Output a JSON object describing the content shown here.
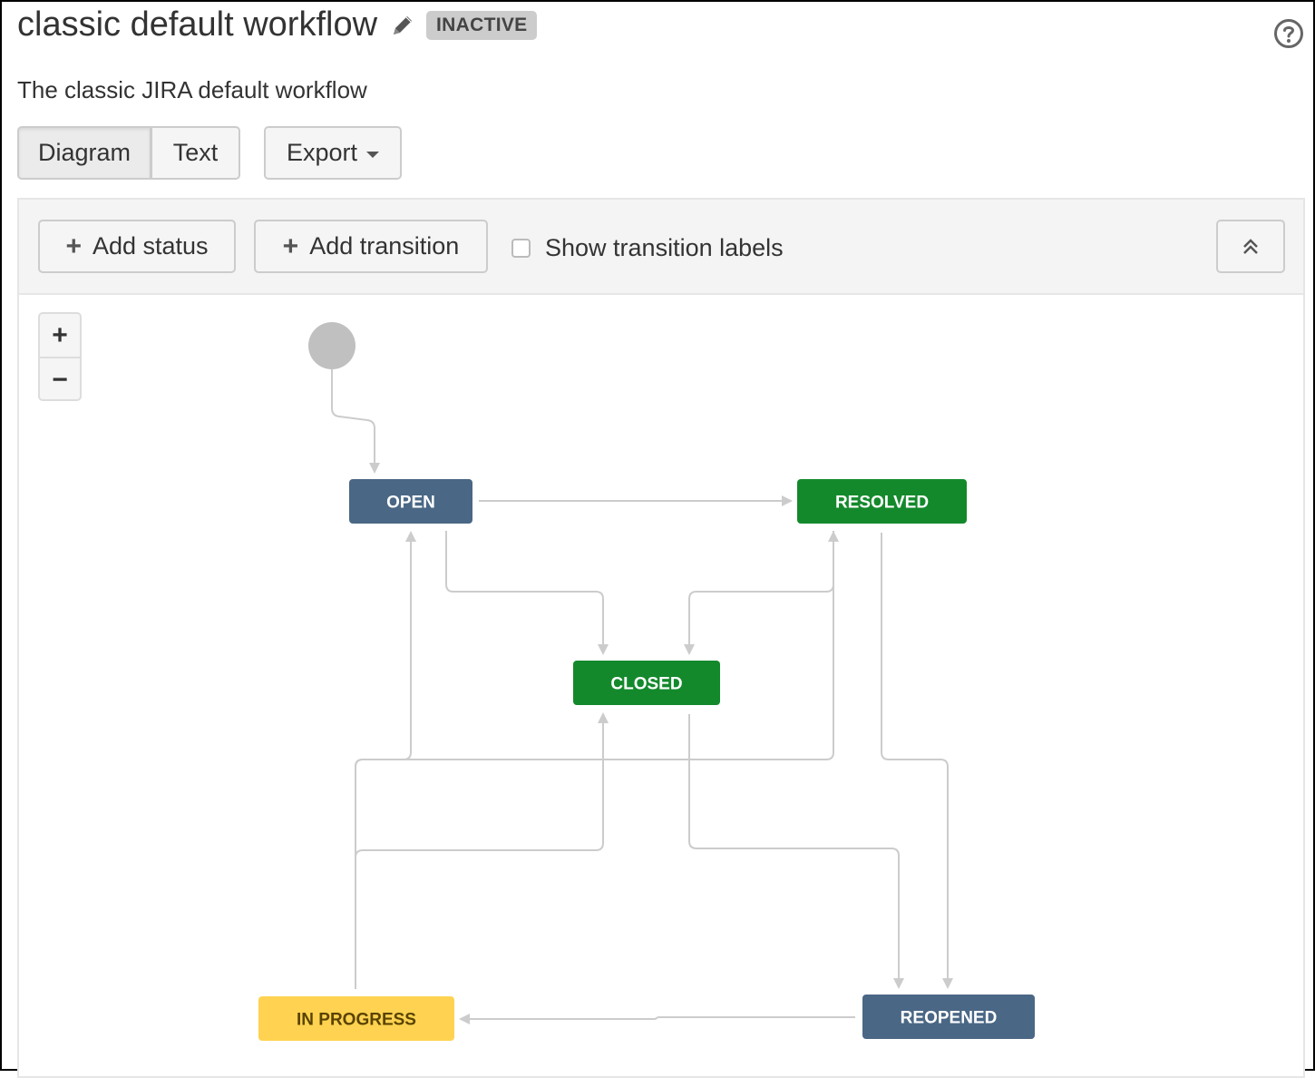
{
  "header": {
    "title": "classic default workflow",
    "edit_icon": "pencil-icon",
    "status_badge": "INACTIVE",
    "help_icon": "question-circle-icon",
    "description": "The classic JIRA default workflow"
  },
  "view_toggle": {
    "diagram_label": "Diagram",
    "text_label": "Text",
    "selected": "Diagram"
  },
  "export": {
    "label": "Export",
    "icon": "caret-down-icon"
  },
  "toolbar": {
    "add_status_label": "Add status",
    "add_transition_label": "Add transition",
    "show_labels_label": "Show transition labels",
    "show_labels_checked": false,
    "collapse_icon": "double-chevron-up-icon"
  },
  "zoom": {
    "zoom_in": "+",
    "zoom_out": "−"
  },
  "colors": {
    "todo": "#4a6785",
    "done": "#14892c",
    "in_progress": "#ffd351",
    "in_progress_text": "#594300",
    "edge": "#cccccc",
    "initial": "#c0c0c0"
  },
  "diagram": {
    "statuses": [
      {
        "id": "open",
        "label": "OPEN",
        "category": "todo"
      },
      {
        "id": "resolved",
        "label": "RESOLVED",
        "category": "done"
      },
      {
        "id": "closed",
        "label": "CLOSED",
        "category": "done"
      },
      {
        "id": "in_progress",
        "label": "IN PROGRESS",
        "category": "in_progress"
      },
      {
        "id": "reopened",
        "label": "REOPENED",
        "category": "todo"
      }
    ],
    "transitions": [
      {
        "from": "initial",
        "to": "open"
      },
      {
        "from": "open",
        "to": "resolved"
      },
      {
        "from": "open",
        "to": "closed"
      },
      {
        "from": "resolved",
        "to": "closed"
      },
      {
        "from": "in_progress",
        "to": "open"
      },
      {
        "from": "in_progress",
        "to": "resolved"
      },
      {
        "from": "in_progress",
        "to": "closed"
      },
      {
        "from": "closed",
        "to": "reopened"
      },
      {
        "from": "resolved",
        "to": "reopened"
      },
      {
        "from": "reopened",
        "to": "in_progress"
      }
    ]
  }
}
